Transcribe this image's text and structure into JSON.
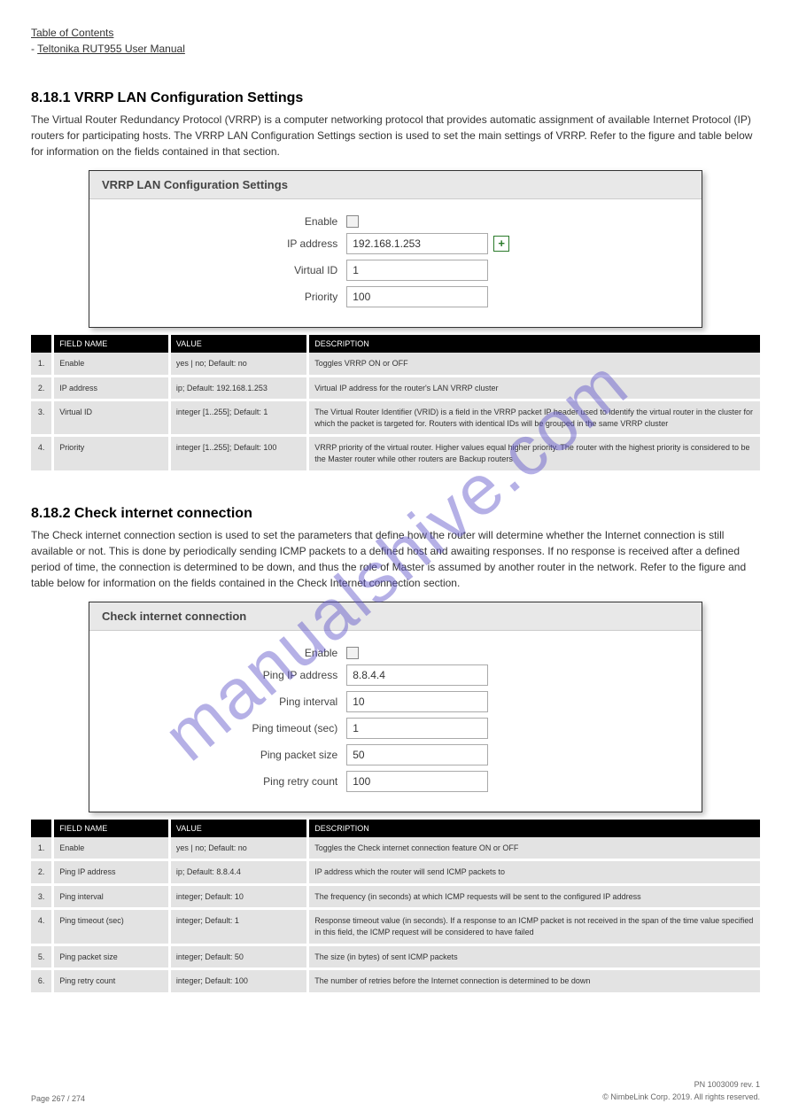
{
  "header": {
    "toc_label": "Table of Contents",
    "breadcrumb_prefix": "- ",
    "breadcrumb": "Teltonika RUT955 User Manual"
  },
  "watermark": "manualshive.com",
  "vrrp_section": {
    "heading": "8.18.1 VRRP LAN Configuration Settings",
    "intro": "The Virtual Router Redundancy Protocol (VRRP) is a computer networking protocol that provides automatic assignment of available Internet Protocol (IP) routers for participating hosts. The VRRP LAN Configuration Settings section is used to set the main settings of VRRP. Refer to the figure and table below for information on the fields contained in that section.",
    "panel_title": "VRRP LAN Configuration Settings",
    "form": {
      "enable_label": "Enable",
      "enable_checked": false,
      "ip_label": "IP address",
      "ip_value": "192.168.1.253",
      "add_glyph": "+",
      "vid_label": "Virtual ID",
      "vid_value": "1",
      "prio_label": "Priority",
      "prio_value": "100"
    },
    "table": {
      "headers": [
        "",
        "FIELD NAME",
        "VALUE",
        "DESCRIPTION"
      ],
      "rows": [
        [
          "1.",
          "Enable",
          "yes | no; Default: no",
          "Toggles VRRP ON or OFF"
        ],
        [
          "2.",
          "IP address",
          "ip; Default: 192.168.1.253",
          "Virtual IP address for the router's LAN VRRP cluster"
        ],
        [
          "3.",
          "Virtual ID",
          "integer [1..255]; Default: 1",
          "The Virtual Router Identifier (VRID) is a field in the VRRP packet IP header used to identify the virtual router in the cluster for which the packet is targeted for. Routers with identical IDs will be grouped in the same VRRP cluster"
        ],
        [
          "4.",
          "Priority",
          "integer [1..255]; Default: 100",
          "VRRP priority of the virtual router. Higher values equal higher priority. The router with the highest priority is considered to be the Master router while other routers are Backup routers"
        ]
      ]
    }
  },
  "check_section": {
    "heading": "8.18.2 Check internet connection",
    "intro": "The Check internet connection section is used to set the parameters that define how the router will determine whether the Internet connection is still available or not. This is done by periodically sending ICMP packets to a defined host and awaiting responses. If no response is received after a defined period of time, the connection is determined to be down, and thus the role of Master is assumed by another router in the network. Refer to the figure and table below for information on the fields contained in the Check Internet connection section.",
    "panel_title": "Check internet connection",
    "form": {
      "enable_label": "Enable",
      "enable_checked": false,
      "ping_ip_label": "Ping IP address",
      "ping_ip_value": "8.8.4.4",
      "ping_interval_label": "Ping interval",
      "ping_interval_value": "10",
      "ping_timeout_label": "Ping timeout (sec)",
      "ping_timeout_value": "1",
      "ping_size_label": "Ping packet size",
      "ping_size_value": "50",
      "ping_retry_label": "Ping retry count",
      "ping_retry_value": "100"
    },
    "table": {
      "headers": [
        "",
        "FIELD NAME",
        "VALUE",
        "DESCRIPTION"
      ],
      "rows": [
        [
          "1.",
          "Enable",
          "yes | no; Default: no",
          "Toggles the Check internet connection feature ON or OFF"
        ],
        [
          "2.",
          "Ping IP address",
          "ip; Default: 8.8.4.4",
          "IP address which the router will send ICMP packets to"
        ],
        [
          "3.",
          "Ping interval",
          "integer; Default: 10",
          "The frequency (in seconds) at which ICMP requests will be sent to the configured IP address"
        ],
        [
          "4.",
          "Ping timeout (sec)",
          "integer; Default: 1",
          "Response timeout value (in seconds). If a response to an ICMP packet is not received in the span of the time value specified in this field, the ICMP request will be considered to have failed"
        ],
        [
          "5.",
          "Ping packet size",
          "integer; Default: 50",
          "The size (in bytes) of sent ICMP packets"
        ],
        [
          "6.",
          "Ping retry count",
          "integer; Default: 100",
          "The number of retries before the Internet connection is determined to be down"
        ]
      ]
    }
  },
  "footer": {
    "page": "Page 267 / 274",
    "line1": "PN 1003009 rev. 1",
    "line2": "© NimbeLink Corp. 2019. All rights reserved."
  }
}
